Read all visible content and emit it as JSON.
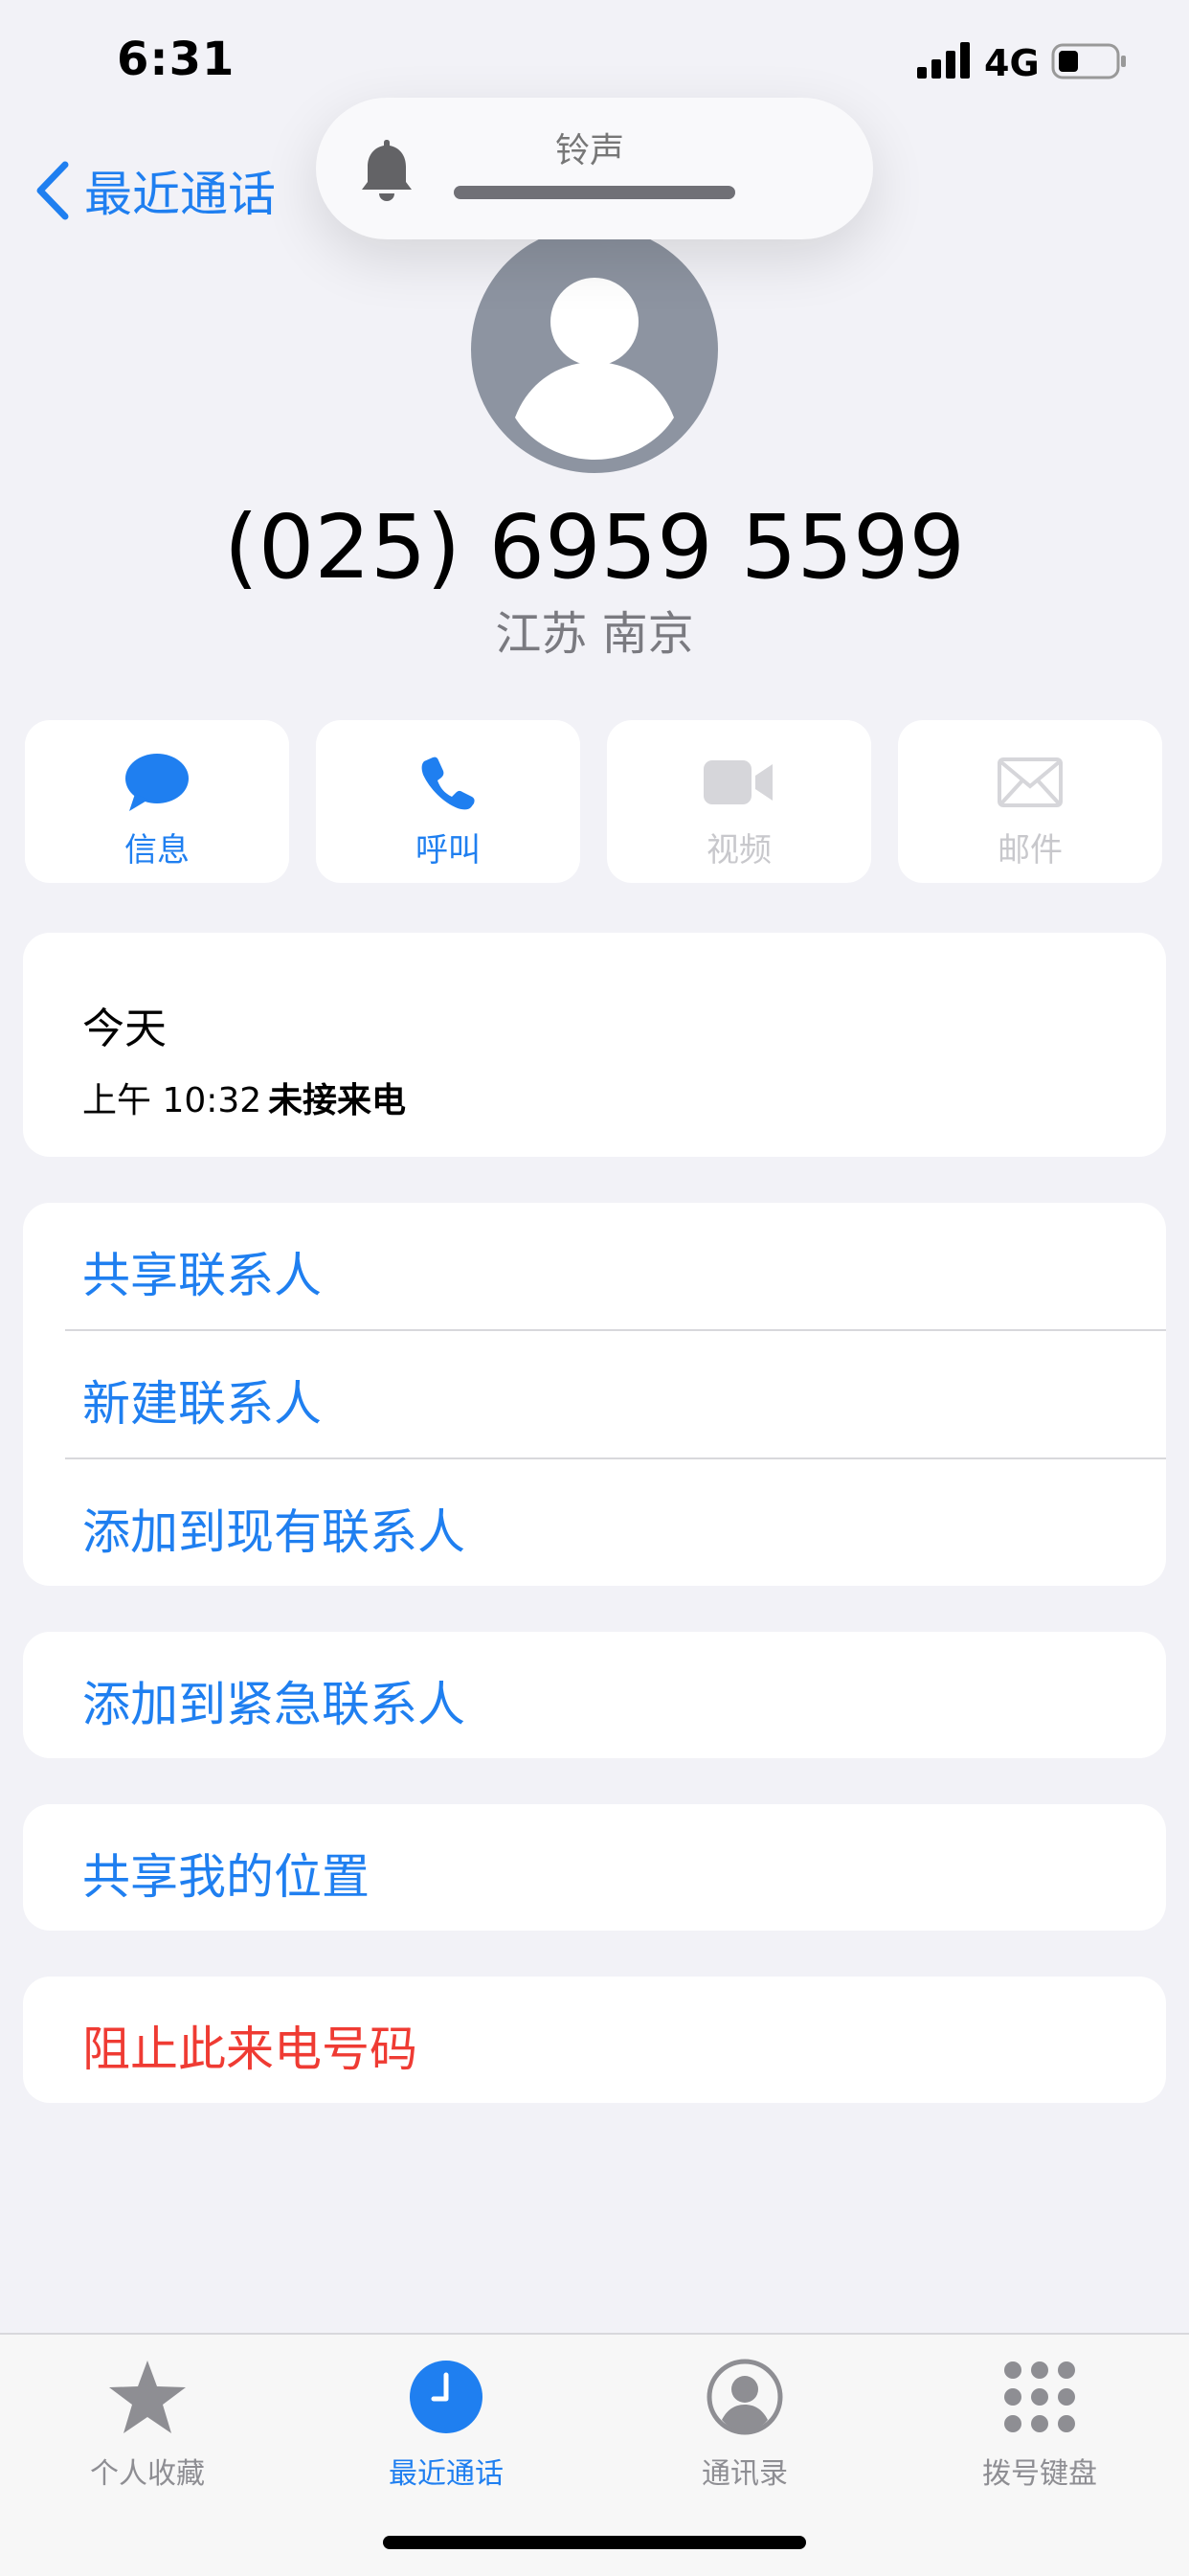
{
  "status": {
    "time": "6:31",
    "network": "4G"
  },
  "nav": {
    "back_label": "最近通话"
  },
  "toast": {
    "label": "铃声"
  },
  "contact": {
    "number": "(025) 6959 5599",
    "location": "江苏 南京"
  },
  "actions": [
    {
      "label": "信息",
      "icon": "message-icon",
      "enabled": true
    },
    {
      "label": "呼叫",
      "icon": "phone-icon",
      "enabled": true
    },
    {
      "label": "视频",
      "icon": "video-icon",
      "enabled": false
    },
    {
      "label": "邮件",
      "icon": "mail-icon",
      "enabled": false
    }
  ],
  "history": {
    "day": "今天",
    "time": "上午 10:32",
    "status": "未接来电"
  },
  "contact_options": [
    "共享联系人",
    "新建联系人",
    "添加到现有联系人"
  ],
  "emergency": {
    "label": "添加到紧急联系人"
  },
  "share_location": {
    "label": "共享我的位置"
  },
  "block": {
    "label": "阻止此来电号码"
  },
  "tabs": [
    {
      "label": "个人收藏",
      "icon": "star-icon",
      "active": false
    },
    {
      "label": "最近通话",
      "icon": "clock-icon",
      "active": true
    },
    {
      "label": "通讯录",
      "icon": "person-circle-icon",
      "active": false
    },
    {
      "label": "拨号键盘",
      "icon": "keypad-icon",
      "active": false
    }
  ],
  "colors": {
    "accent": "#1f7ff0",
    "destructive": "#ef3b33",
    "background": "#f2f2f7"
  }
}
